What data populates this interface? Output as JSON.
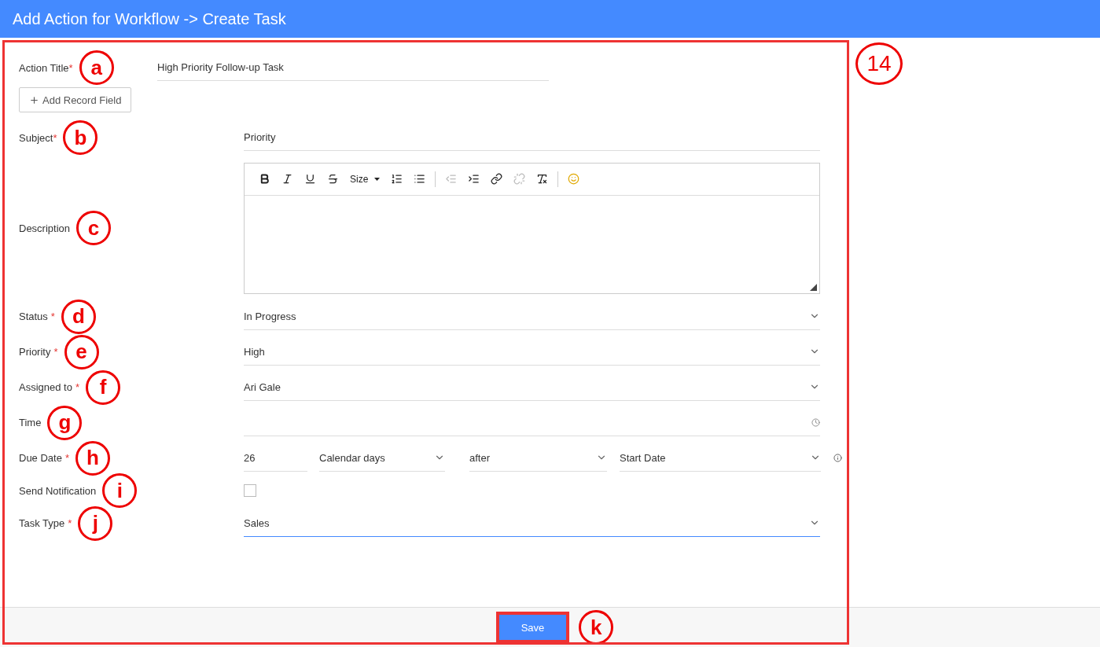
{
  "header": {
    "title": "Add Action for Workflow -> Create Task"
  },
  "action_title": {
    "label": "Action Title",
    "required_mark": "*",
    "value": "High Priority Follow-up Task",
    "callout": "a"
  },
  "add_field_button": {
    "label": "Add Record Field"
  },
  "fields": [
    {
      "kind": "text",
      "label": "Subject",
      "required_mark": "*",
      "value": "Priority",
      "callout": "b"
    },
    {
      "kind": "richtext",
      "label": "Description",
      "callout": "c",
      "size_label": "Size",
      "tool_groups": [
        [
          {
            "kind": "bold",
            "disabled": false
          },
          {
            "kind": "italic",
            "disabled": false
          },
          {
            "kind": "underline",
            "disabled": false
          },
          {
            "kind": "strike",
            "disabled": false
          },
          {
            "kind": "size",
            "disabled": false
          },
          {
            "kind": "ordered",
            "disabled": false
          },
          {
            "kind": "bullets",
            "disabled": false
          }
        ],
        [
          {
            "kind": "outdent",
            "disabled": true
          },
          {
            "kind": "indent",
            "disabled": false
          },
          {
            "kind": "link",
            "disabled": false
          },
          {
            "kind": "unlink",
            "disabled": true
          },
          {
            "kind": "clear",
            "disabled": false
          }
        ],
        [
          {
            "kind": "emoji",
            "disabled": false
          }
        ]
      ]
    },
    {
      "kind": "select",
      "label": "Status",
      "required_mark": "*",
      "value": "In Progress",
      "callout": "d",
      "focused": false
    },
    {
      "kind": "select",
      "label": "Priority",
      "required_mark": "*",
      "value": "High",
      "callout": "e",
      "focused": false
    },
    {
      "kind": "select",
      "label": "Assigned to",
      "required_mark": "*",
      "value": "Ari Gale",
      "callout": "f",
      "focused": false
    },
    {
      "kind": "time",
      "label": "Time",
      "callout": "g"
    },
    {
      "kind": "due",
      "label": "Due Date",
      "required_mark": "*",
      "callout": "h",
      "amount": "26",
      "unit": "Calendar days",
      "relation": "after",
      "reference": "Start Date"
    },
    {
      "kind": "checkbox",
      "label": "Send Notification",
      "callout": "i",
      "checked": false
    },
    {
      "kind": "select",
      "label": "Task Type",
      "required_mark": "*",
      "value": "Sales",
      "callout": "j",
      "focused": true
    }
  ],
  "footer": {
    "save": "Save",
    "callout": "k"
  },
  "panel_callout": "14"
}
